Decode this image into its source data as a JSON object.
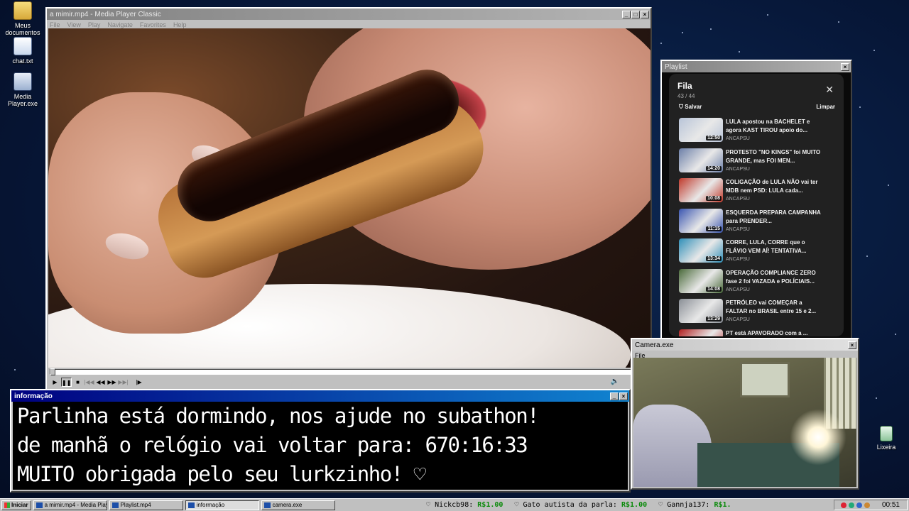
{
  "desktop": {
    "icons": [
      {
        "label": "Meus documentos"
      },
      {
        "label": "chat.txt"
      },
      {
        "label": "Media Player.exe"
      },
      {
        "label": "Lixeira"
      }
    ]
  },
  "media_player": {
    "title": "a mimir.mp4 - Media Player Classic",
    "menu": [
      "File",
      "View",
      "Play",
      "Navigate",
      "Favorites",
      "Help"
    ],
    "controls": [
      "▶",
      "❚❚",
      "■",
      "|◀◀",
      "◀◀",
      "▶▶",
      "▶▶|",
      "|▶"
    ],
    "volume_icon": "🔈",
    "seek_position": 0.0
  },
  "playlist": {
    "window_title": "Playlist",
    "title": "Fila",
    "count": "43 / 44",
    "save_label": "Salvar",
    "clear_label": "Limpar",
    "close_glyph": "✕",
    "save_glyph": "⛉",
    "items": [
      {
        "title": "LULA apostou na BACHELET e agora KAST TIROU apoio do...",
        "channel": "ANCAPSU",
        "duration": "12:50",
        "thumb_color": "#b8c4d8"
      },
      {
        "title": "PROTESTO \"NO KINGS\" foi MUITO GRANDE, mas FOI MEN...",
        "channel": "ANCAPSU",
        "duration": "14:20",
        "thumb_color": "#6c7fa8"
      },
      {
        "title": "COLIGAÇÃO de LULA NÃO vai ter MDB nem PSD: LULA cada...",
        "channel": "ANCAPSU",
        "duration": "10:08",
        "thumb_color": "#c0392b"
      },
      {
        "title": "ESQUERDA PREPARA CAMPANHA para PRENDER...",
        "channel": "ANCAPSU",
        "duration": "11:15",
        "thumb_color": "#3a55b0"
      },
      {
        "title": "CORRE, LULA, CORRE que o FLÁVIO VEM AÍ! TENTATIVA...",
        "channel": "ANCAPSU",
        "duration": "13:34",
        "thumb_color": "#2f8fb8"
      },
      {
        "title": "OPERAÇÃO COMPLIANCE ZERO fase 2 foi VAZADA e POLÍCIAIS...",
        "channel": "ANCAPSU",
        "duration": "14:08",
        "thumb_color": "#4a6a3a"
      },
      {
        "title": "PETRÓLEO vai COMEÇAR a FALTAR no BRASIL entre 15 e 2...",
        "channel": "ANCAPSU",
        "duration": "13:29",
        "thumb_color": "#8a8f96"
      },
      {
        "title": "PT está APAVORADO com a ...",
        "channel": "ANCAPSU",
        "duration": "",
        "thumb_color": "#b02020"
      }
    ]
  },
  "info_window": {
    "title": "informação",
    "lines": [
      "Parlinha está dormindo, nos ajude no subathon!",
      "de manhã o relógio vai voltar para:  670:16:33",
      "MUITO obrigada pelo seu lurkzinho! ♡"
    ]
  },
  "camera_window": {
    "title": "Camera.exe",
    "menu": [
      "File"
    ]
  },
  "taskbar": {
    "start_label": "Iniciar",
    "tasks": [
      {
        "label": "a mimir.mp4 - Media Playe..."
      },
      {
        "label": "Playlist.mp4"
      },
      {
        "label": "informação"
      },
      {
        "label": "camera.exe"
      }
    ],
    "ticker": [
      {
        "name": "Nickcb98:",
        "amount": "R$1.00"
      },
      {
        "name": "Gato autista da parla:",
        "amount": "R$1.00"
      },
      {
        "name": "Gannja137:",
        "amount": "R$1."
      }
    ],
    "ticker_heart": "♡",
    "clock": "00:51"
  },
  "colors": {
    "desktop_bg": "#07183a",
    "active_title": "#000080",
    "money_green": "#0a8a0a"
  }
}
